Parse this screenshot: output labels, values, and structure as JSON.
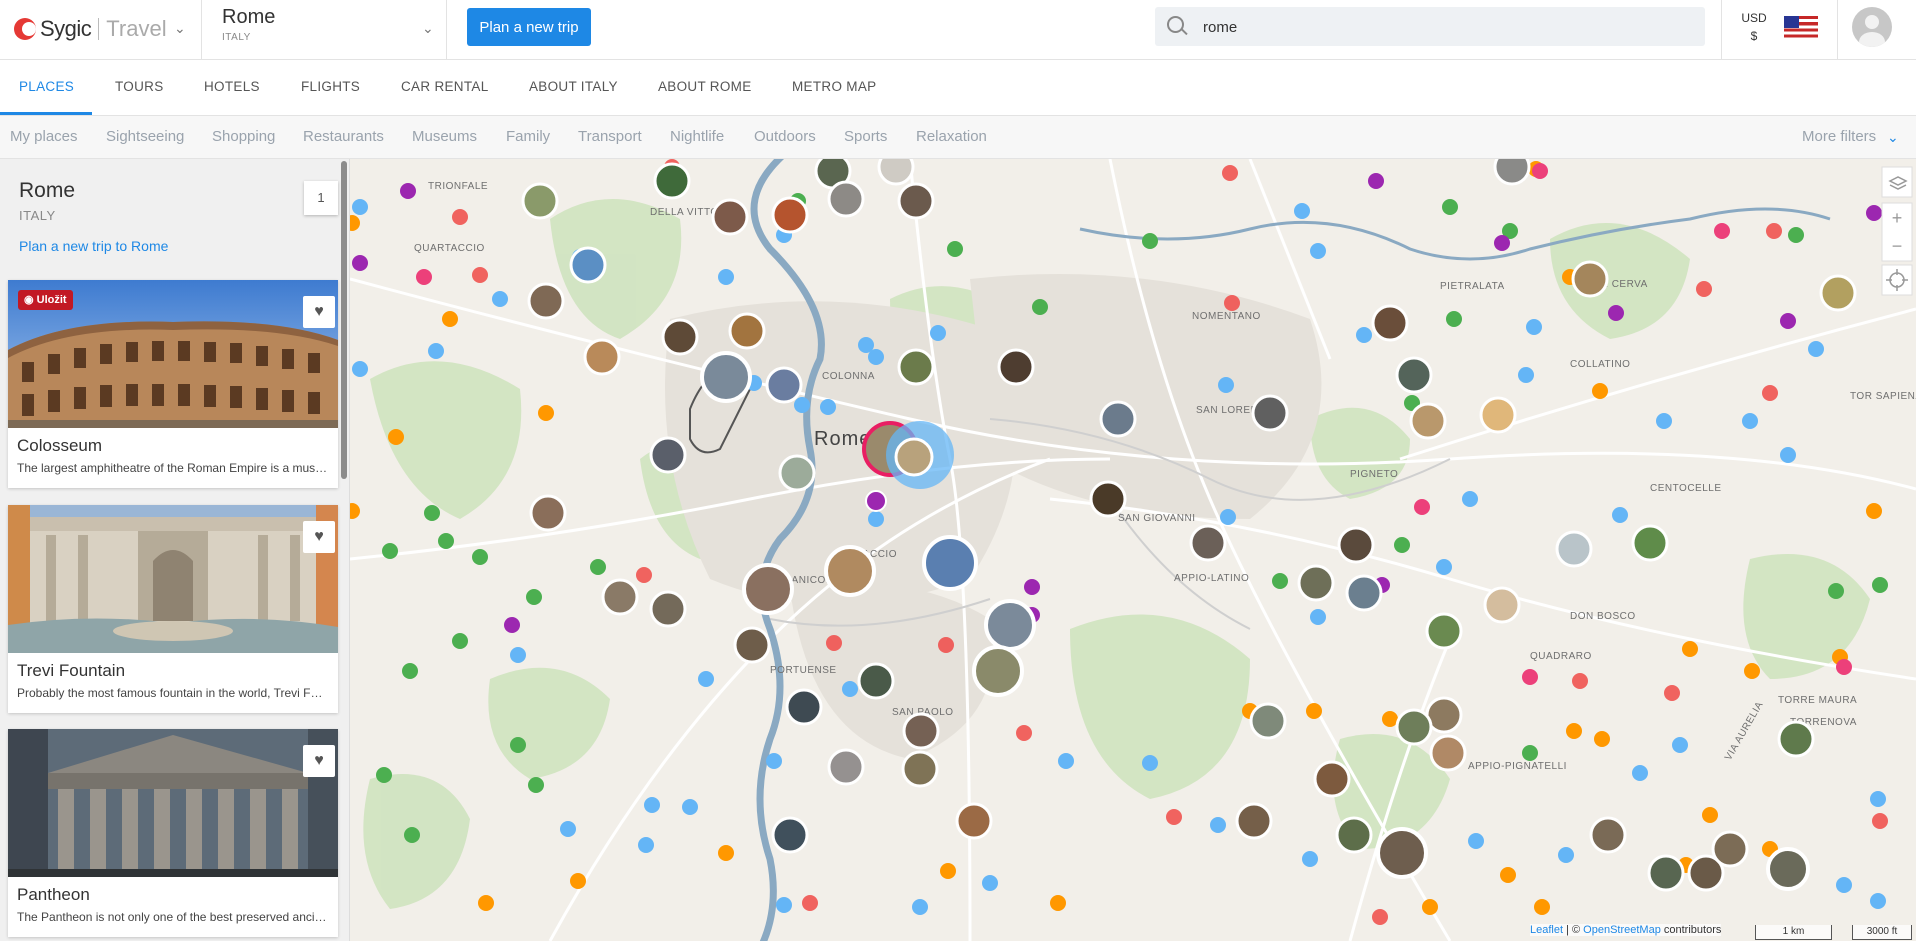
{
  "header": {
    "logo_brand": "Sygic",
    "logo_product": "Travel",
    "destination_title": "Rome",
    "destination_country": "ITALY",
    "plan_button": "Plan a new trip",
    "search_value": "rome",
    "currency_code": "USD",
    "currency_symbol": "$"
  },
  "tabs": [
    {
      "label": "PLACES",
      "active": true
    },
    {
      "label": "TOURS"
    },
    {
      "label": "HOTELS"
    },
    {
      "label": "FLIGHTS"
    },
    {
      "label": "CAR RENTAL"
    },
    {
      "label": "ABOUT ITALY"
    },
    {
      "label": "ABOUT ROME"
    },
    {
      "label": "METRO MAP"
    }
  ],
  "filters": [
    "My places",
    "Sightseeing",
    "Shopping",
    "Restaurants",
    "Museums",
    "Family",
    "Transport",
    "Nightlife",
    "Outdoors",
    "Sports",
    "Relaxation"
  ],
  "more_filters": "More filters",
  "sidebar": {
    "title": "Rome",
    "country": "ITALY",
    "plan_link": "Plan a new trip to Rome",
    "count": "1",
    "places": [
      {
        "title": "Colosseum",
        "desc": "The largest amphitheatre of the Roman Empire is a must-see monument of ancient Rome.",
        "badge": "Uložit"
      },
      {
        "title": "Trevi Fountain",
        "desc": "Probably the most famous fountain in the world, Trevi Fountain is a Baroque masterpiece."
      },
      {
        "title": "Pantheon",
        "desc": "The Pantheon is not only one of the best preserved ancient Roman buildings."
      }
    ]
  },
  "map": {
    "center_label": "Rome",
    "district_labels": [
      "TRIONFALE",
      "QUARTACCIO",
      "DELLA VITTORIA",
      "NOMENTANO",
      "PIETRALATA",
      "TOR CERVA",
      "TOR SAPIENZA",
      "COLONNA",
      "SAN LORENZO",
      "PIGNETO",
      "SAN GIOVANNI",
      "APPIO-LATINO",
      "TESTACCIO",
      "GIANICOLENSE",
      "PORTUENSE",
      "SAN PAOLO",
      "TORRENOVA",
      "TOR SAPIENZA",
      "VIA AURELIA",
      "APPIO-PIGNATELLI",
      "DON BOSCO",
      "QUADRARO",
      "TORRE MAURA",
      "CENTOCELLE",
      "COLLATINO"
    ],
    "attribution_leaflet": "Leaflet",
    "attribution_osm": "OpenStreetMap",
    "attribution_rest": "contributors",
    "scale_km": "1 km",
    "scale_ft": "3000 ft",
    "zoom_in": "+",
    "zoom_out": "−"
  },
  "colors": {
    "accent": "#1e88e5",
    "pin_green": "#4caf50",
    "pin_orange": "#ff9800",
    "pin_red": "#ef5350",
    "pin_blue": "#64b5f6",
    "pin_purple": "#9c27b0",
    "pin_pink": "#ec407a"
  }
}
